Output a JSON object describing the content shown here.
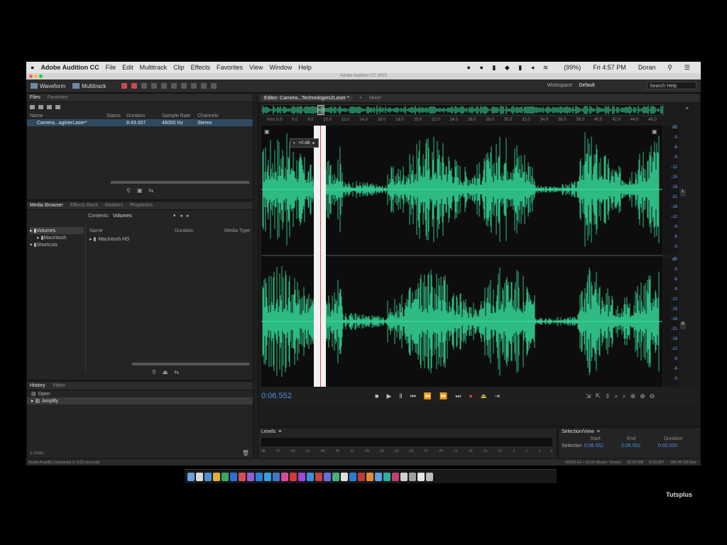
{
  "menu": {
    "app_name": "Adobe Audition CC",
    "items": [
      "File",
      "Edit",
      "Multitrack",
      "Clip",
      "Effects",
      "Favorites",
      "View",
      "Window",
      "Help"
    ],
    "clock": "Fri 4:57 PM",
    "user": "Doran",
    "battery": "(99%)"
  },
  "window": {
    "title": "Adobe Audition CC 2015"
  },
  "toolbar": {
    "waveform_label": "Waveform",
    "multitrack_label": "Multitrack",
    "workspace_label": "Workspace:",
    "workspace_value": "Default",
    "search_placeholder": "Search Help"
  },
  "files_panel": {
    "tabs": [
      "Files",
      "Favorites"
    ],
    "columns": [
      "Name",
      "Status",
      "Duration",
      "Sample Rate",
      "Channels"
    ],
    "row": {
      "name": "Camera...aginerLaser*",
      "duration": "8:43.007",
      "sample_rate": "48000 Hz",
      "channels": "Stereo"
    }
  },
  "media_panel": {
    "tabs": [
      "Media Browser",
      "Effects Rack",
      "Markers",
      "Properties"
    ],
    "contents_label": "Contents:",
    "contents_value": "Volumes",
    "columns": [
      "Name",
      "Duration",
      "Media Type"
    ],
    "tree": [
      "Volumes",
      "Macintosh",
      "Shortcuts"
    ],
    "files": [
      "Macintosh HD"
    ]
  },
  "history_panel": {
    "tabs": [
      "History",
      "Video"
    ],
    "items": [
      "Open",
      "Amplify"
    ],
    "undo_label": "1 Undo"
  },
  "editor": {
    "tab_label": "Editor: Camera...Technologies2Laser *",
    "mixer_tab": "Mixer",
    "time_labels": [
      "hms 0.0",
      "6.0",
      "8.0",
      "10.0",
      "12.0",
      "14.0",
      "16.0",
      "18.0",
      "20.0",
      "22.0",
      "24.0",
      "26.0",
      "28.0",
      "30.0",
      "32.0",
      "34.0",
      "36.0",
      "38.0",
      "40.0",
      "42.0",
      "44.0",
      "46.0"
    ],
    "hud_value": "+0 dB",
    "db_ticks_top": [
      "dB",
      "-3",
      "-6",
      "-9",
      "-12",
      "-15",
      "-18",
      "-21",
      "-18",
      "-12",
      "-9",
      "-6",
      "-3"
    ],
    "db_ticks_bottom": [
      "dB",
      "-3",
      "-6",
      "-9",
      "-12",
      "-15",
      "-18",
      "-21",
      "-18",
      "-12",
      "-9",
      "-6",
      "-3"
    ],
    "current_time": "0:06.552",
    "channel_labels": [
      "L",
      "R"
    ]
  },
  "levels": {
    "title": "Levels",
    "scale": [
      "dB",
      "-57",
      "-54",
      "-51",
      "-48",
      "-45",
      "-42",
      "-39",
      "-36",
      "-33",
      "-30",
      "-27",
      "-24",
      "-21",
      "-18",
      "-15",
      "-12",
      "-9",
      "-6",
      "-3",
      "0"
    ]
  },
  "selection_view": {
    "title": "Selection/View",
    "headers": [
      "Start",
      "End",
      "Duration"
    ],
    "row_label": "Selection",
    "start": "0:06.552",
    "end": "0:06.552",
    "duration": "0:00.000"
  },
  "statusbar": {
    "left": "Audio Amplify completed in 0.62 seconds",
    "format": "48000 Hz • 32-bit (float) • Stereo",
    "size": "33.93 MB",
    "duration": "8:43.007",
    "free": "186.49 GB free"
  },
  "colors": {
    "waveform": "#38e6a2",
    "background": "#000000",
    "selection": "#f2f2f2",
    "playhead": "#cf4a4a"
  },
  "watermark": "Tutsplus"
}
